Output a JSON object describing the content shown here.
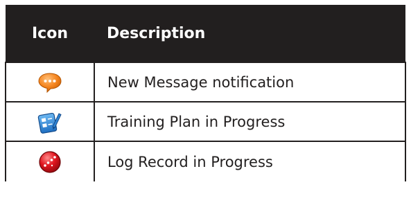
{
  "table": {
    "headers": {
      "icon": "Icon",
      "description": "Description"
    },
    "rows": [
      {
        "icon": "message-bubble-icon",
        "description": "New Message notification"
      },
      {
        "icon": "training-plan-icon",
        "description": "Training Plan in Progress"
      },
      {
        "icon": "log-record-icon",
        "description": "Log Record in Progress"
      }
    ]
  },
  "colors": {
    "header_bg": "#221f1f",
    "header_text": "#ffffff",
    "message_icon": "#f5851f",
    "training_icon": "#2f86d6",
    "log_icon": "#e0151e"
  }
}
